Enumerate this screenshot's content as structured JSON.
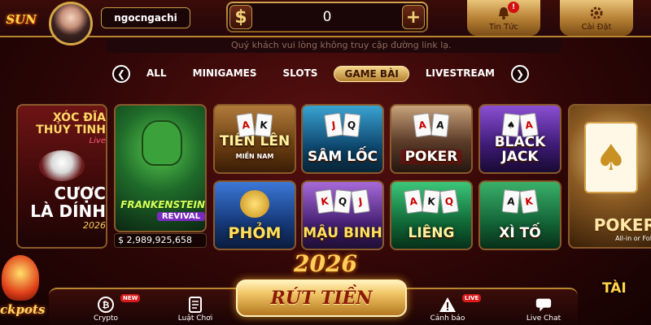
{
  "logo": {
    "text": "SUN"
  },
  "user": {
    "username": "ngocngachi"
  },
  "balance": {
    "minus_icon": "$",
    "value": "0",
    "plus_icon": "+"
  },
  "top_actions": [
    {
      "label": "Tin Tức",
      "icon": "bell-icon",
      "badge": "!"
    },
    {
      "label": "Cài Đặt",
      "icon": "gear-icon"
    }
  ],
  "notice": {
    "text": "Quý khách vui lòng không truy cập đường link lạ."
  },
  "tabs": {
    "items": [
      "ALL",
      "MINIGAMES",
      "SLOTS",
      "GAME BÀI",
      "LIVESTREAM"
    ],
    "active_index": 3
  },
  "games": {
    "xoc_dia": {
      "line1": "XÓC ĐĨA",
      "line2": "THỦY TINH",
      "live": "Live",
      "line3": "CƯỢC",
      "line4": "LÀ DÍNH",
      "year": "2026"
    },
    "frankenstein": {
      "title": "FRANKENSTEIN",
      "sub": "REVIVAL",
      "jackpot": "$ 2,989,925,658"
    },
    "tien_len": {
      "title": "TIẾN LÊN",
      "sub": "MIỀN NAM"
    },
    "sam_loc": {
      "title": "SÂM LỐC"
    },
    "poker": {
      "title": "POKER"
    },
    "black_jack": {
      "title": "BLACK JACK"
    },
    "poker_fold": {
      "title": "POKER",
      "sub": "All-in or Fold"
    },
    "phom": {
      "title": "PHỎM"
    },
    "mau_binh": {
      "title": "MẬU BINH"
    },
    "lieng": {
      "title": "LIÊNG"
    },
    "xi_to": {
      "title": "XÌ TỐ"
    }
  },
  "decor": {
    "year": "2026",
    "jackpots": "ckpots",
    "tai": "TÀI"
  },
  "bottom_bar": {
    "withdraw": "RÚT TIỀN",
    "items": [
      {
        "label": "Crypto",
        "badge": "NEW",
        "icon": "bitcoin-icon"
      },
      {
        "label": "Luật Chơi",
        "icon": "rules-book-icon"
      },
      {
        "label": "Cảnh báo",
        "badge": "LIVE",
        "icon": "warning-icon"
      },
      {
        "label": "Live Chat",
        "icon": "chat-icon"
      }
    ]
  },
  "colors": {
    "gold": "#f7d97a",
    "dark_red": "#2e0606",
    "alert_red": "#d21010"
  }
}
